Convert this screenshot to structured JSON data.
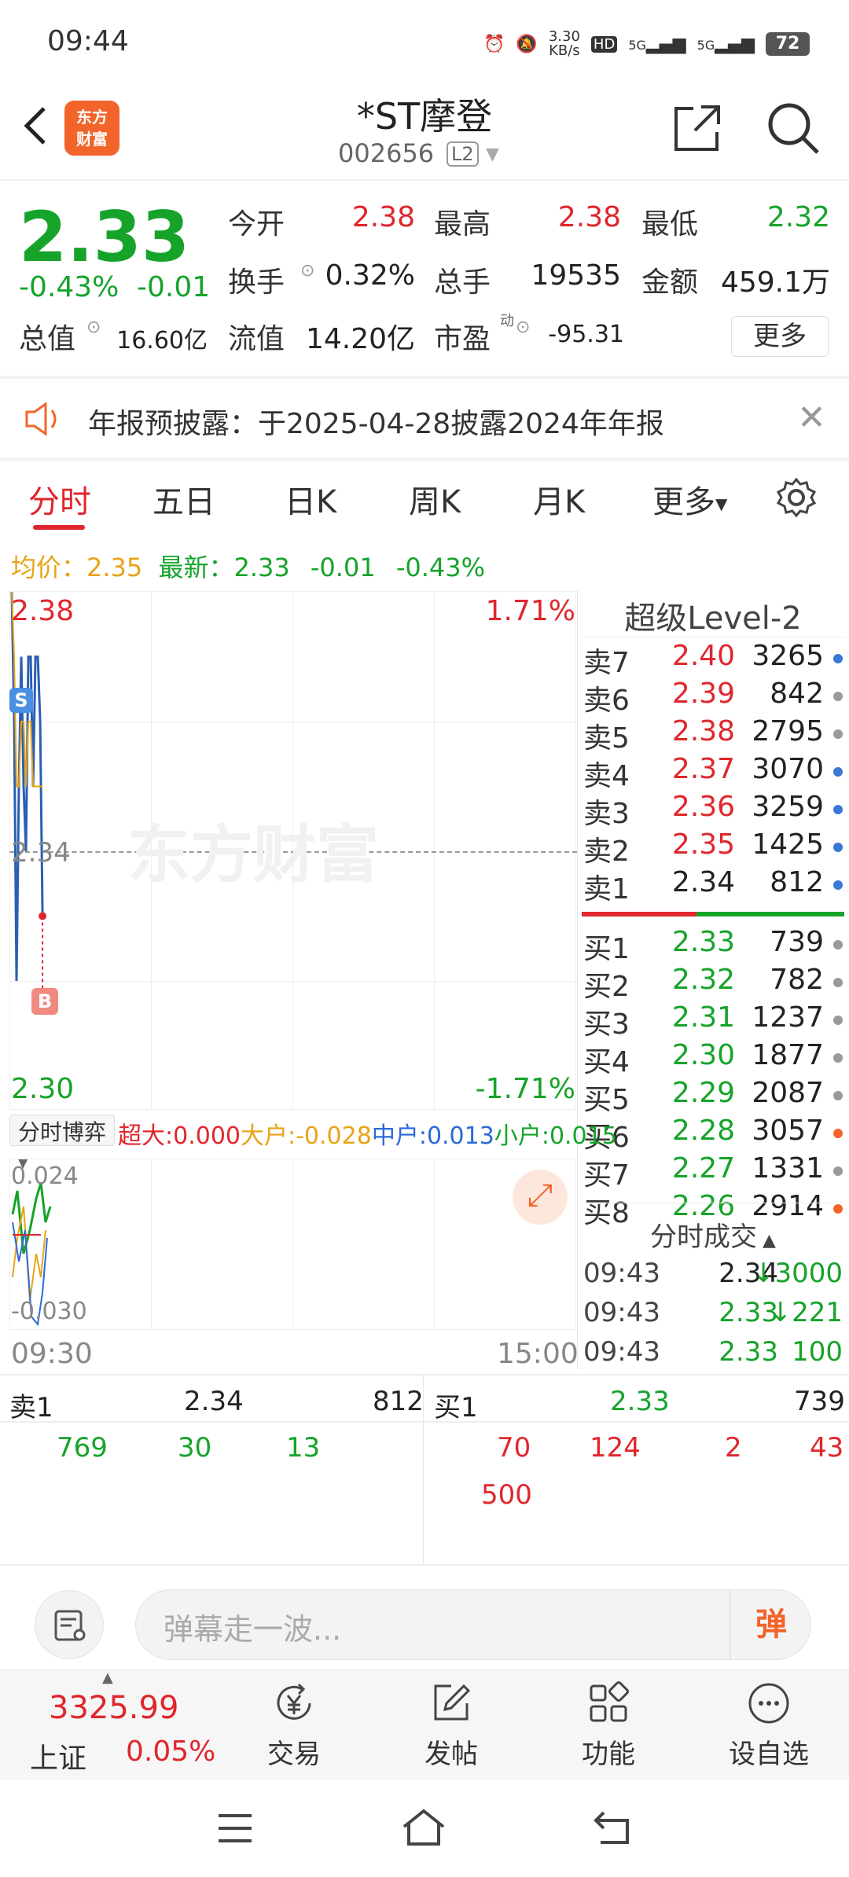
{
  "status_bar": {
    "time": "09:44",
    "net_speed_value": "3.30",
    "net_speed_unit": "KB/s",
    "hd": "HD",
    "signal1": "5G",
    "signal2": "5G",
    "battery": "72"
  },
  "header": {
    "logo_line1": "东方",
    "logo_line2": "财富",
    "stock_name": "*ST摩登",
    "stock_code": "002656",
    "level_badge": "L2"
  },
  "quote": {
    "price": "2.33",
    "change_pct": "-0.43%",
    "change": "-0.01",
    "fields": [
      {
        "label": "今开",
        "value": "2.38",
        "color": "red"
      },
      {
        "label": "最高",
        "value": "2.38",
        "color": "red"
      },
      {
        "label": "最低",
        "value": "2.32",
        "color": "green"
      },
      {
        "label": "换手",
        "value": "0.32%",
        "color": "dark"
      },
      {
        "label": "总手",
        "value": "19535",
        "color": "dark"
      },
      {
        "label": "金额",
        "value": "459.1万",
        "color": "dark"
      },
      {
        "label": "总值",
        "value": "16.60亿",
        "color": "dark"
      },
      {
        "label": "流值",
        "value": "14.20亿",
        "color": "dark"
      },
      {
        "label": "市盈",
        "sup": "动",
        "value": "-95.31",
        "color": "dark"
      }
    ],
    "more_button": "更多"
  },
  "notice": {
    "text": "年报预披露：于2025-04-28披露2024年年报"
  },
  "tabs": [
    "分时",
    "五日",
    "日K",
    "周K",
    "月K",
    "更多"
  ],
  "avg_line": {
    "avg_label": "均价：",
    "avg_value": "2.35",
    "latest_label": "最新：",
    "latest_value": "2.33",
    "change": "-0.01",
    "change_pct": "-0.43%"
  },
  "chart": {
    "y_top": "2.38",
    "y_mid": "2.34",
    "y_bottom": "2.30",
    "pct_top": "1.71%",
    "pct_bottom": "-1.71%",
    "marker_sell": "S",
    "marker_buy": "B",
    "watermark": "东方财富",
    "time_start": "09:30",
    "time_end": "15:00",
    "sub_top": "0.024",
    "sub_bottom": "-0.030"
  },
  "chart_data": {
    "type": "line",
    "title": "",
    "xlabel": "",
    "ylabel": "",
    "ylim": [
      2.3,
      2.38
    ],
    "x": [
      "09:30",
      "09:31",
      "09:32",
      "09:33",
      "09:34",
      "09:35",
      "09:36",
      "09:37",
      "09:38",
      "09:39",
      "09:40",
      "09:41",
      "09:42",
      "09:43"
    ],
    "series": [
      {
        "name": "",
        "values": [
          2.38,
          2.36,
          2.32,
          2.35,
          2.37,
          2.35,
          2.34,
          2.37,
          2.37,
          2.35,
          2.37,
          2.37,
          2.36,
          2.33
        ]
      },
      {
        "name": "均价",
        "values": [
          2.38,
          2.37,
          2.35,
          2.35,
          2.36,
          2.36,
          2.35,
          2.36,
          2.36,
          2.35,
          2.35,
          2.35,
          2.35,
          2.35
        ]
      }
    ]
  },
  "fund_flow": {
    "selector": "分时博弈",
    "items": [
      {
        "label": "超大:",
        "value": "0.000",
        "color": "#e0262c"
      },
      {
        "label": "大户:",
        "value": "-0.028",
        "color": "#e8a317"
      },
      {
        "label": "中户:",
        "value": "0.013",
        "color": "#2a6ad9"
      },
      {
        "label": "小户:",
        "value": "0.015",
        "color": "#16a32a"
      }
    ]
  },
  "order_book": {
    "title": "超级Level-2",
    "asks": [
      {
        "label": "卖7",
        "price": "2.40",
        "vol": "3265",
        "dot": "#3a78d6",
        "color": "red"
      },
      {
        "label": "卖6",
        "price": "2.39",
        "vol": "842",
        "dot": "#999999",
        "color": "red"
      },
      {
        "label": "卖5",
        "price": "2.38",
        "vol": "2795",
        "dot": "#999999",
        "color": "red"
      },
      {
        "label": "卖4",
        "price": "2.37",
        "vol": "3070",
        "dot": "#3a78d6",
        "color": "red"
      },
      {
        "label": "卖3",
        "price": "2.36",
        "vol": "3259",
        "dot": "#3a78d6",
        "color": "red"
      },
      {
        "label": "卖2",
        "price": "2.35",
        "vol": "1425",
        "dot": "#3a78d6",
        "color": "red"
      },
      {
        "label": "卖1",
        "price": "2.34",
        "vol": "812",
        "dot": "#3a78d6",
        "color": "dark"
      }
    ],
    "bids": [
      {
        "label": "买1",
        "price": "2.33",
        "vol": "739",
        "dot": "#999999",
        "color": "green"
      },
      {
        "label": "买2",
        "price": "2.32",
        "vol": "782",
        "dot": "#999999",
        "color": "green"
      },
      {
        "label": "买3",
        "price": "2.31",
        "vol": "1237",
        "dot": "#999999",
        "color": "green"
      },
      {
        "label": "买4",
        "price": "2.30",
        "vol": "1877",
        "dot": "#999999",
        "color": "green"
      },
      {
        "label": "买5",
        "price": "2.29",
        "vol": "2087",
        "dot": "#999999",
        "color": "green"
      },
      {
        "label": "买6",
        "price": "2.28",
        "vol": "3057",
        "dot": "#f2642a",
        "color": "green"
      },
      {
        "label": "买7",
        "price": "2.27",
        "vol": "1331",
        "dot": "#999999",
        "color": "green"
      },
      {
        "label": "买8",
        "price": "2.26",
        "vol": "2914",
        "dot": "#f2642a",
        "color": "green"
      }
    ]
  },
  "trades": {
    "title": "分时成交",
    "rows": [
      {
        "time": "09:43",
        "price": "2.34",
        "arrow": "↓",
        "vol": "3000",
        "pcolor": "dark",
        "vcolor": "green"
      },
      {
        "time": "09:43",
        "price": "2.33",
        "arrow": "↓",
        "vol": "221",
        "pcolor": "green",
        "vcolor": "green"
      },
      {
        "time": "09:43",
        "price": "2.33",
        "arrow": "",
        "vol": "100",
        "pcolor": "green",
        "vcolor": "green"
      }
    ]
  },
  "queue": {
    "ask_label": "卖1",
    "ask_price": "2.34",
    "ask_vol": "812",
    "bid_label": "买1",
    "bid_price": "2.33",
    "bid_vol": "739",
    "ask_orders": [
      "769",
      "30",
      "13"
    ],
    "bid_orders_row1": [
      "70",
      "124",
      "2",
      "43"
    ],
    "bid_orders_row2": [
      "500"
    ]
  },
  "comment": {
    "placeholder": "弹幕走一波...",
    "danmaku_label": "弹"
  },
  "bottom_nav": {
    "index_value": "3325.99",
    "index_name": "上证",
    "index_pct": "0.05%",
    "items": [
      "交易",
      "发帖",
      "功能",
      "设自选"
    ]
  }
}
